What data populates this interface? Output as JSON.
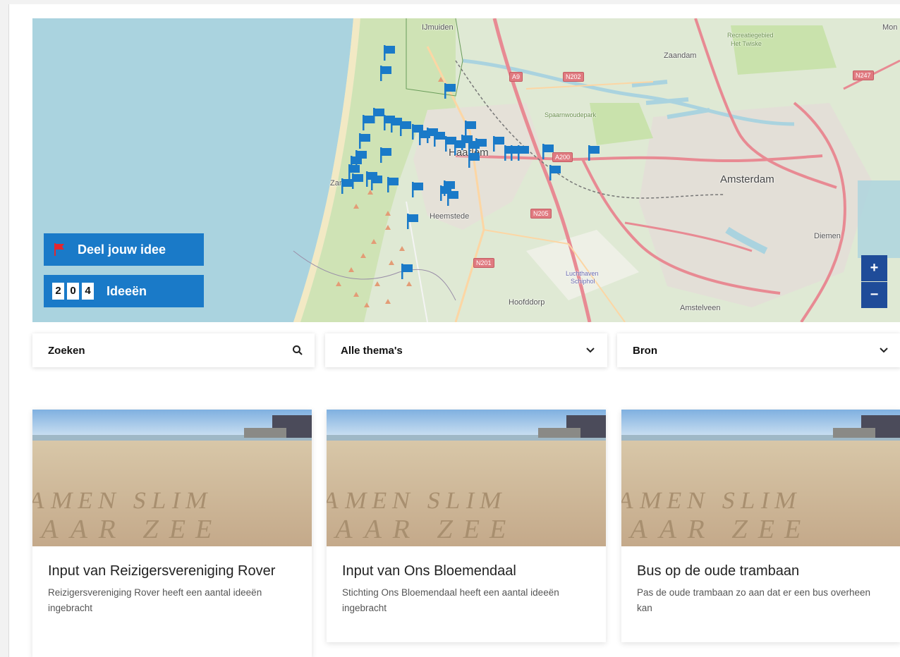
{
  "map": {
    "places": {
      "ijmuiden": "IJmuiden",
      "zaandam": "Zaandam",
      "haarlem": "Haarlem",
      "amsterdam": "Amsterdam",
      "heemstede": "Heemstede",
      "hoofddorp": "Hoofddorp",
      "amstelveen": "Amstelveen",
      "diemen": "Diemen",
      "zandvoort": "Zan",
      "spaarnwoudepark": "Spaarnwoudepark",
      "recreatie": "Recreatiegebied",
      "het_twiske": "Het Twiske",
      "luchthaven": "Luchthaven",
      "schiphol": "Schiphol",
      "mon": "Mon"
    },
    "roads": {
      "a9": "A9",
      "n202": "N202",
      "n247": "N247",
      "a200": "A200",
      "n205": "N205",
      "n201": "N201"
    },
    "marker_color": "#1a7ac8",
    "share_button": {
      "label": "Deel jouw idee"
    },
    "idea_count": {
      "digits": [
        "2",
        "0",
        "4"
      ],
      "label": "Ideeën"
    },
    "zoom_in": "+",
    "zoom_out": "−"
  },
  "filters": {
    "search": {
      "label": "Zoeken",
      "icon": "search-icon"
    },
    "theme": {
      "label": "Alle thema's",
      "icon": "chevron-down-icon"
    },
    "source": {
      "label": "Bron",
      "icon": "chevron-down-icon"
    }
  },
  "cards": [
    {
      "title": "Input van Reizigersvereniging Rover",
      "description": "Reizigersvereniging Rover heeft een aantal ideeën ingebracht"
    },
    {
      "title": "Input van Ons Bloemendaal",
      "description": "Stichting Ons Bloemendaal heeft een aantal ideeën ingebracht"
    },
    {
      "title": "Bus op de oude trambaan",
      "description": "Pas de oude trambaan zo aan dat er een bus overheen kan"
    }
  ],
  "photo_sand_text": {
    "line1": "SAMEN SLIM",
    "line2": "NAAR ZEE"
  }
}
